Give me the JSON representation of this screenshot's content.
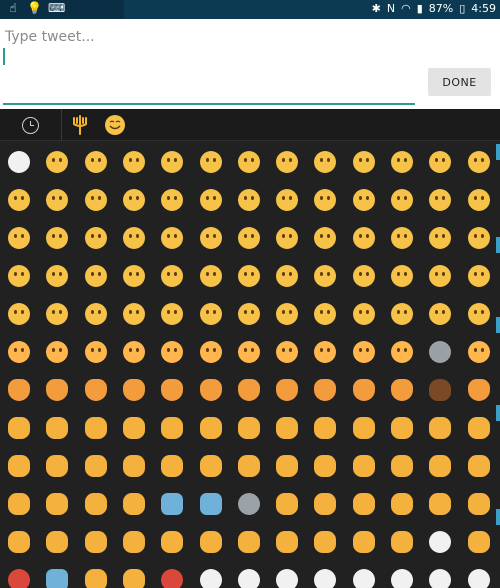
{
  "status_bar": {
    "battery": "87%",
    "time": "4:59",
    "left_icons": [
      "notification-icon",
      "bulb-icon",
      "keyboard-icon"
    ],
    "right_icons": [
      "bluetooth-icon",
      "nfc-icon",
      "wifi-icon",
      "signal-icon",
      "battery-icon"
    ]
  },
  "compose": {
    "placeholder": "Type tweet...",
    "value": "",
    "done_label": "DONE"
  },
  "emoji_keyboard": {
    "tabs": [
      {
        "name": "recent",
        "icon": "clock-icon"
      },
      {
        "name": "category",
        "icon": "trident-icon"
      },
      {
        "name": "smileys",
        "icon": "smiley-icon"
      }
    ],
    "accent_color": "#2a9d8f",
    "grid": {
      "columns": 13,
      "rows": [
        [
          "😀",
          "😊",
          "😁",
          "😁",
          "😂",
          "😃",
          "😄",
          "😆",
          "😆",
          "😇",
          "😈",
          "😉",
          "😊"
        ],
        [
          "😊",
          "🙂",
          "😐",
          "😑",
          "😒",
          "😓",
          "😔",
          "😖",
          "😞",
          "😟",
          "😤",
          "😯",
          "😥"
        ],
        [
          "😑",
          "😩",
          "😔",
          "😦",
          "😬",
          "😩",
          "😰",
          "😨",
          "😱",
          "😲",
          "😣",
          "😵",
          "😖"
        ],
        [
          "😷",
          "😦",
          "😒",
          "😍",
          "😋",
          "😏",
          "😠",
          "😜",
          "😙",
          "😗",
          "😘",
          "😚",
          "😳"
        ],
        [
          "😭",
          "😌",
          "😫",
          "😣",
          "😌",
          "😏",
          "🤑",
          "🤓",
          "😎",
          "🤔",
          "😐",
          "😶",
          "😑"
        ],
        [
          "🤕",
          "😞",
          "😫",
          "🙋",
          "🙏",
          "🙆",
          "🙅",
          "🙆",
          "🙇",
          "🙎",
          "🙌",
          "☹",
          "🐱"
        ],
        [
          "😺",
          "😸",
          "😹",
          "😻",
          "😼",
          "😽",
          "🙀",
          "😿",
          "🙈",
          "🙉",
          "🙊",
          "💩",
          "👶"
        ],
        [
          "👦",
          "👧",
          "👨",
          "👩",
          "👴",
          "👵",
          "💑",
          "💑",
          "💏",
          "💏",
          "💏",
          "💏",
          "👪"
        ],
        [
          "👪",
          "👪",
          "👪",
          "👪",
          "👪",
          "👪",
          "👪",
          "👪",
          "👪",
          "👪",
          "👪",
          "👪",
          "👪"
        ],
        [
          "👫",
          "👬",
          "👭",
          "👯",
          "👤",
          "👥",
          "🗨",
          "👮",
          "🕵",
          "👷",
          "💂",
          "💂",
          "🐰"
        ],
        [
          "👰",
          "👸",
          "🎅",
          "👼",
          "👱",
          "👲",
          "👳",
          "🚶",
          "👶",
          "💇",
          "💅",
          "👻",
          "👽"
        ],
        [
          "🤡",
          "👽",
          "👾",
          "🤖",
          "😈",
          "💀",
          "💪",
          "👀",
          "👁",
          "👂",
          "👃",
          "👣",
          "👄"
        ]
      ]
    }
  }
}
